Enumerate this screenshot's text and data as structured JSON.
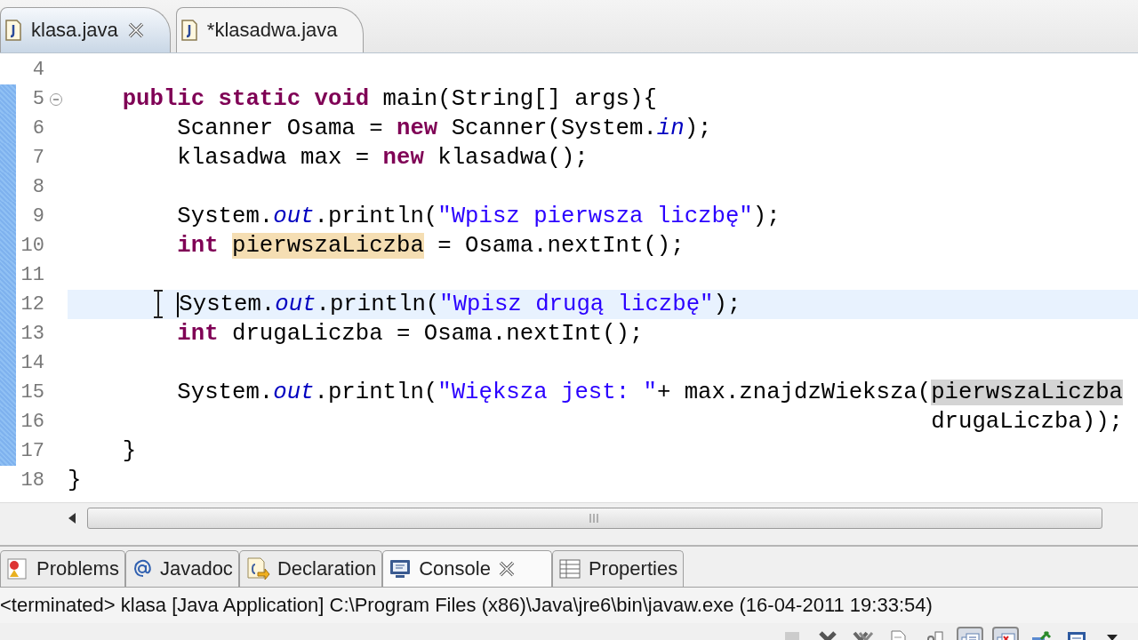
{
  "editor_tabs": [
    {
      "label": "klasa.java",
      "selected": true,
      "closable": true
    },
    {
      "label": "*klasadwa.java",
      "selected": false,
      "closable": false
    }
  ],
  "code_lines": [
    {
      "number": "4",
      "changed": false
    },
    {
      "number": "5",
      "changed": true,
      "foldable": true,
      "tokens": [
        {
          "kind": "keyword",
          "text": "    public static void"
        },
        {
          "kind": "plain",
          "text": " main(String[] args){"
        }
      ]
    },
    {
      "number": "6",
      "changed": true,
      "tokens": [
        {
          "kind": "plain",
          "text": "        Scanner Osama = "
        },
        {
          "kind": "keyword",
          "text": "new"
        },
        {
          "kind": "plain",
          "text": " Scanner(System."
        },
        {
          "kind": "field",
          "text": "in"
        },
        {
          "kind": "plain",
          "text": ");"
        }
      ]
    },
    {
      "number": "7",
      "changed": true,
      "tokens": [
        {
          "kind": "plain",
          "text": "        klasadwa max = "
        },
        {
          "kind": "keyword",
          "text": "new"
        },
        {
          "kind": "plain",
          "text": " klasadwa();"
        }
      ]
    },
    {
      "number": "8",
      "changed": true
    },
    {
      "number": "9",
      "changed": true,
      "tokens": [
        {
          "kind": "plain",
          "text": "        System."
        },
        {
          "kind": "field",
          "text": "out"
        },
        {
          "kind": "plain",
          "text": ".println("
        },
        {
          "kind": "string",
          "text": "\"Wpisz pierwsza liczbę\""
        },
        {
          "kind": "plain",
          "text": ");"
        }
      ]
    },
    {
      "number": "10",
      "changed": true,
      "tokens": [
        {
          "kind": "keyword",
          "text": "        int "
        },
        {
          "kind": "occurrence",
          "text": "pierwszaLiczba"
        },
        {
          "kind": "plain",
          "text": " = Osama.nextInt();"
        }
      ]
    },
    {
      "number": "11",
      "changed": true
    },
    {
      "number": "12",
      "changed": true,
      "current": true,
      "tokens": [
        {
          "kind": "plain",
          "text": "        System."
        },
        {
          "kind": "field",
          "text": "out"
        },
        {
          "kind": "plain",
          "text": ".println("
        },
        {
          "kind": "string",
          "text": "\"Wpisz drugą liczbę\""
        },
        {
          "kind": "plain",
          "text": ");"
        }
      ]
    },
    {
      "number": "13",
      "changed": true,
      "tokens": [
        {
          "kind": "keyword",
          "text": "        int "
        },
        {
          "kind": "plain",
          "text": "drugaLiczba = Osama.nextInt();"
        }
      ]
    },
    {
      "number": "14",
      "changed": true
    },
    {
      "number": "15",
      "changed": true,
      "tokens": [
        {
          "kind": "plain",
          "text": "        System."
        },
        {
          "kind": "field",
          "text": "out"
        },
        {
          "kind": "plain",
          "text": ".println("
        },
        {
          "kind": "string",
          "text": "\"Większa jest: \""
        },
        {
          "kind": "plain",
          "text": "+ max.znajdzWieksza("
        },
        {
          "kind": "read",
          "text": "pierwszaLiczba"
        }
      ]
    },
    {
      "number": "16",
      "changed": true,
      "tokens": [
        {
          "kind": "plain",
          "text": "                                                               drugaLiczba));"
        }
      ]
    },
    {
      "number": "17",
      "changed": true,
      "tokens": [
        {
          "kind": "plain",
          "text": "    }"
        }
      ]
    },
    {
      "number": "18",
      "changed": false,
      "tokens": [
        {
          "kind": "plain",
          "text": "}"
        }
      ]
    }
  ],
  "panel_tabs": [
    {
      "label": "Problems",
      "selected": false,
      "closable": false
    },
    {
      "label": "Javadoc",
      "selected": false,
      "closable": false
    },
    {
      "label": "Declaration",
      "selected": false,
      "closable": false
    },
    {
      "label": "Console",
      "selected": true,
      "closable": true
    },
    {
      "label": "Properties",
      "selected": false,
      "closable": false
    }
  ],
  "console": {
    "status": "<terminated> klasa [Java Application] C:\\Program Files (x86)\\Java\\jre6\\bin\\javaw.exe (16-04-2011 19:33:54)"
  },
  "console_toolbar": [
    {
      "disabled": true,
      "pressed": false
    },
    {
      "disabled": false,
      "pressed": false
    },
    {
      "disabled": false,
      "pressed": false
    },
    {
      "disabled": false,
      "pressed": false
    },
    {
      "disabled": false,
      "pressed": false
    },
    {
      "disabled": false,
      "pressed": true
    },
    {
      "disabled": false,
      "pressed": true
    },
    {
      "disabled": false,
      "pressed": false
    },
    {
      "disabled": false,
      "pressed": false
    },
    {
      "disabled": false,
      "pressed": false
    }
  ]
}
